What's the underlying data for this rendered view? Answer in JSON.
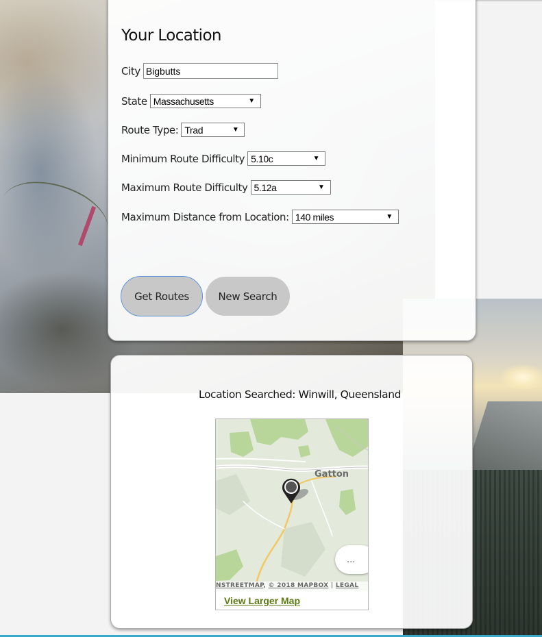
{
  "form": {
    "title": "Your Location",
    "city_label": "City",
    "city_value": "Bigbutts",
    "state_label": "State",
    "state_value": "Massachusetts",
    "route_type_label": "Route Type:",
    "route_type_value": "Trad",
    "min_difficulty_label": "Minimum Route Difficulty",
    "min_difficulty_value": "5.10c",
    "max_difficulty_label": "Maximum Route Difficulty",
    "max_difficulty_value": "5.12a",
    "max_distance_label": "Maximum Distance from Location:",
    "max_distance_value": "140 miles",
    "get_routes_label": "Get Routes",
    "new_search_label": "New Search"
  },
  "result": {
    "location_searched": "Location Searched: Winwill, Queensland",
    "map": {
      "town_label": "Gatton",
      "more_button_label": "...",
      "attribution_osm": "NSTREETMAP",
      "attribution_mapbox": "© 2018 MAPBOX",
      "attribution_sep": "|",
      "attribution_legal": "LEGAL",
      "view_larger_label": "View Larger Map"
    }
  },
  "icons": {
    "select_arrow": "dropdown-arrow-icon",
    "map_pin": "map-pin-icon"
  },
  "colors": {
    "button_bg": "#c8c8c8",
    "focus_outline": "#5b8fd6",
    "map_link": "#5c7a12",
    "bottom_rule": "#3aa8c9"
  }
}
